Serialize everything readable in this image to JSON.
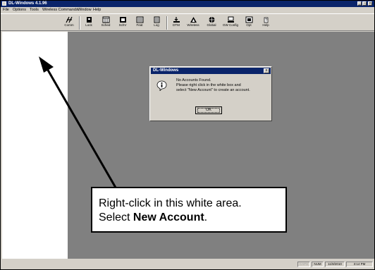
{
  "window": {
    "title": "DL-Windows 4.1.96"
  },
  "menu": [
    "File",
    "Options",
    "Tools",
    "Wireless Commands",
    "Window",
    "Help"
  ],
  "toolbar": [
    {
      "label": "Comm",
      "icon": "comm-icon"
    },
    {
      "label": "Lock",
      "icon": "lock-icon"
    },
    {
      "label": "Sched",
      "icon": "schedule-icon"
    },
    {
      "label": "SchV",
      "icon": "schedule-view-icon"
    },
    {
      "label": "Feat",
      "icon": "features-icon"
    },
    {
      "label": "Log",
      "icon": "log-icon"
    },
    {
      "label": "DTM",
      "icon": "dtm-icon"
    },
    {
      "label": "Wireless",
      "icon": "wireless-icon"
    },
    {
      "label": "Global",
      "icon": "global-icon"
    },
    {
      "label": "GW Config",
      "icon": "gateway-config-icon"
    },
    {
      "label": "Opt",
      "icon": "options-icon"
    },
    {
      "label": "Help",
      "icon": "help-icon"
    }
  ],
  "dialog": {
    "title": "DL-Windows",
    "close": "x",
    "line1": "No Accounts Found.",
    "line2": "Please right click in the white box and",
    "line3": "select \"New Account\" to create an account.",
    "ok": "OK",
    "icon": "info-icon"
  },
  "callout": {
    "line1": "Right-click in this white area.",
    "line2_prefix": "Select ",
    "line2_bold": "New Account",
    "line2_suffix": "."
  },
  "status": {
    "caps": "CAPS",
    "num": "NUM",
    "date": "11/9/2010",
    "time": "3:14 PM"
  },
  "colors": {
    "titlebar": "#0a246a",
    "face": "#d4d0c8",
    "mdi": "#808080"
  }
}
